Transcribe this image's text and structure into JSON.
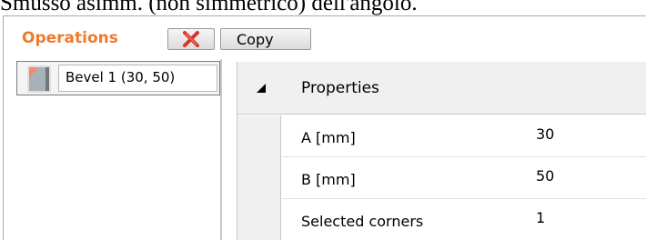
{
  "document": {
    "caption_text": "Smusso asimm. (non simmetrico) dell'angolo."
  },
  "toolbar": {
    "title": "Operations",
    "delete_icon": "delete-x-icon",
    "copy_label": "Copy"
  },
  "operations_list": {
    "items": [
      {
        "icon": "bevel-icon",
        "label": "Bevel  1 (30, 50)"
      }
    ]
  },
  "properties": {
    "header": "Properties",
    "collapse_icon": "collapse-triangle-icon",
    "rows": [
      {
        "key": "A [mm]",
        "value": "30"
      },
      {
        "key": "B [mm]",
        "value": "50"
      },
      {
        "key": "Selected corners",
        "value": "1"
      }
    ]
  },
  "colors": {
    "accent": "#f07a2a",
    "delete_red": "#d9342b",
    "bevel_fill": "#f28b6b",
    "panel_gray": "#f0f0f0"
  }
}
